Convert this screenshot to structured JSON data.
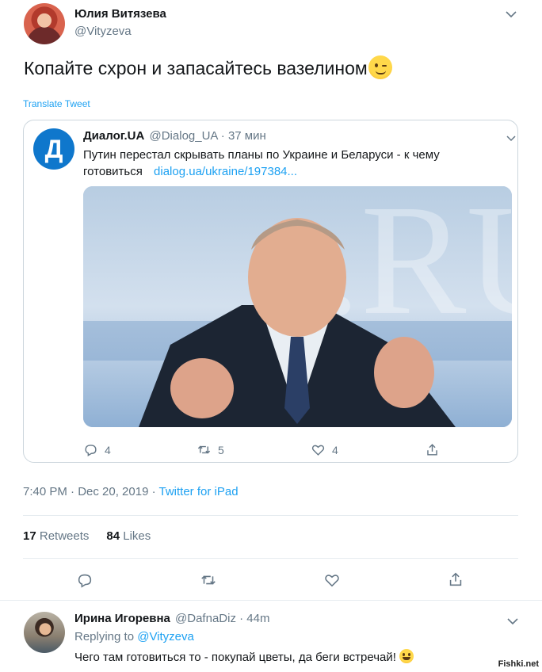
{
  "tweet": {
    "author_name": "Юлия Витязева",
    "author_handle": "@Vityzeva",
    "text": "Копайте схрон и запасайтесь вазелином",
    "translate_label": "Translate Tweet",
    "timestamp": "7:40 PM · Dec 20, 2019",
    "separator": " · ",
    "source": "Twitter for iPad",
    "retweets_count": "17",
    "retweets_label": "Retweets",
    "likes_count": "84",
    "likes_label": "Likes"
  },
  "quote": {
    "logo_letter": "Д",
    "author_name": "Диалог.UA",
    "author_handle": "@Dialog_UA",
    "dot": "·",
    "time": "37 мин",
    "text_line1": "Путин перестал скрывать планы по Украине и Беларуси - к чему",
    "text_line2": "готовиться",
    "link": "dialog.ua/ukraine/197384...",
    "reply_count": "4",
    "retweet_count": "5",
    "like_count": "4"
  },
  "reply": {
    "author_name": "Ирина Игоревна",
    "author_handle": "@DafnaDiz",
    "dot": "·",
    "time": "44m",
    "replying_label": "Replying to",
    "replying_user": "@Vityzeva",
    "text": "Чего там готовиться то - покупай цветы, да беги встречай!"
  },
  "watermark": "Fishki.net",
  "icons": {
    "caret": "chevron-down-icon",
    "reply": "reply-icon",
    "retweet": "retweet-icon",
    "like": "heart-icon",
    "share": "share-icon"
  },
  "colors": {
    "accent": "#1da1f2",
    "muted": "#657786",
    "text": "#14171a",
    "border": "#ccd6dd"
  }
}
